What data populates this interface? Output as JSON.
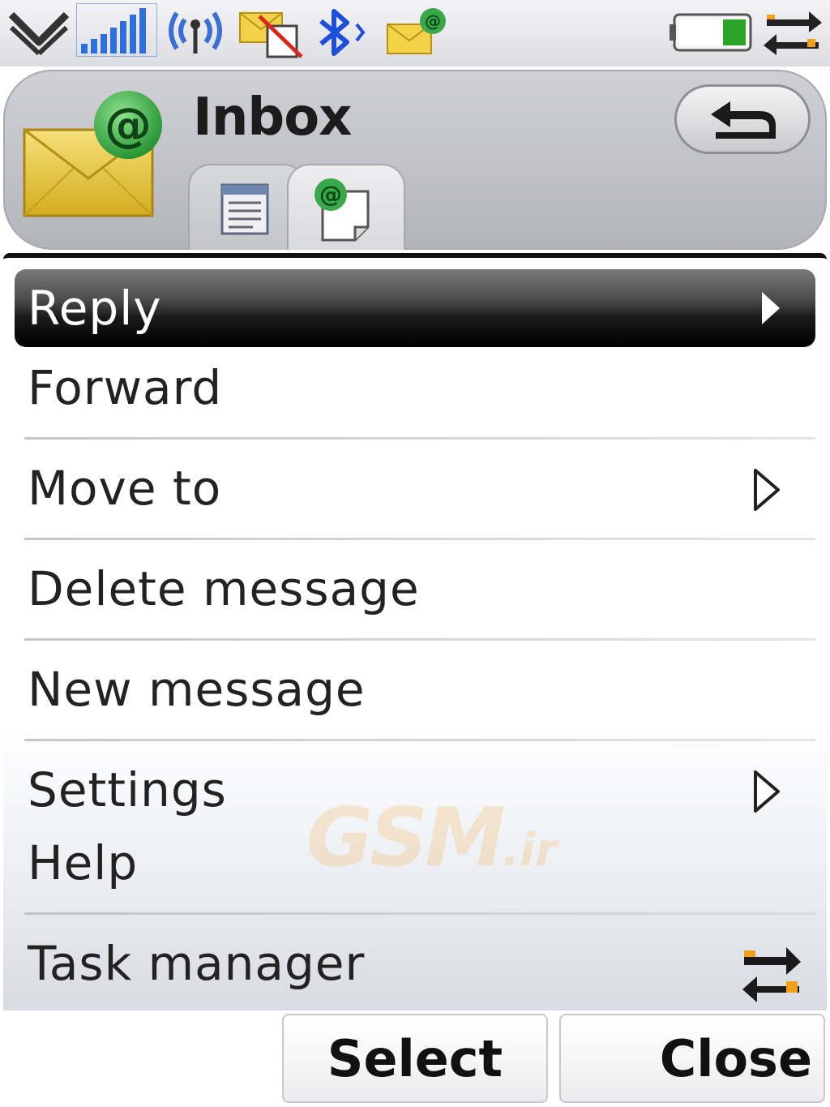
{
  "status_bar": {
    "icons": [
      "dropdown-chevron-icon",
      "signal-strength-icon",
      "radio-waves-icon",
      "no-mail-icon",
      "bluetooth-icon",
      "email-notification-icon",
      "battery-icon",
      "task-switch-icon"
    ]
  },
  "header": {
    "title": "Inbox",
    "app_icon": "envelope-at-icon",
    "back_icon": "back-arrow-icon",
    "tabs": [
      {
        "icon": "message-list-icon",
        "selected": false
      },
      {
        "icon": "email-document-icon",
        "selected": true
      }
    ]
  },
  "menu": {
    "items": [
      {
        "label": "Reply",
        "has_submenu": true,
        "selected": true
      },
      {
        "label": "Forward",
        "has_submenu": false
      },
      {
        "label": "Move to",
        "has_submenu": true
      },
      {
        "label": "Delete message",
        "has_submenu": false
      },
      {
        "label": "New message",
        "has_submenu": false
      },
      {
        "label": "Settings",
        "has_submenu": true
      },
      {
        "label": "Help",
        "has_submenu": false
      },
      {
        "label": "Task manager",
        "has_submenu": false,
        "icon": "task-switch-icon"
      }
    ]
  },
  "watermark": {
    "text": "GSM",
    "tld": ".ir"
  },
  "softkeys": {
    "left": "Select",
    "right": "Close"
  },
  "colors": {
    "highlight": "#000000",
    "header_bg": "#c4c5ca",
    "signal_blue": "#2f6fd6",
    "battery_green": "#29a329",
    "orange": "#f0a020"
  }
}
